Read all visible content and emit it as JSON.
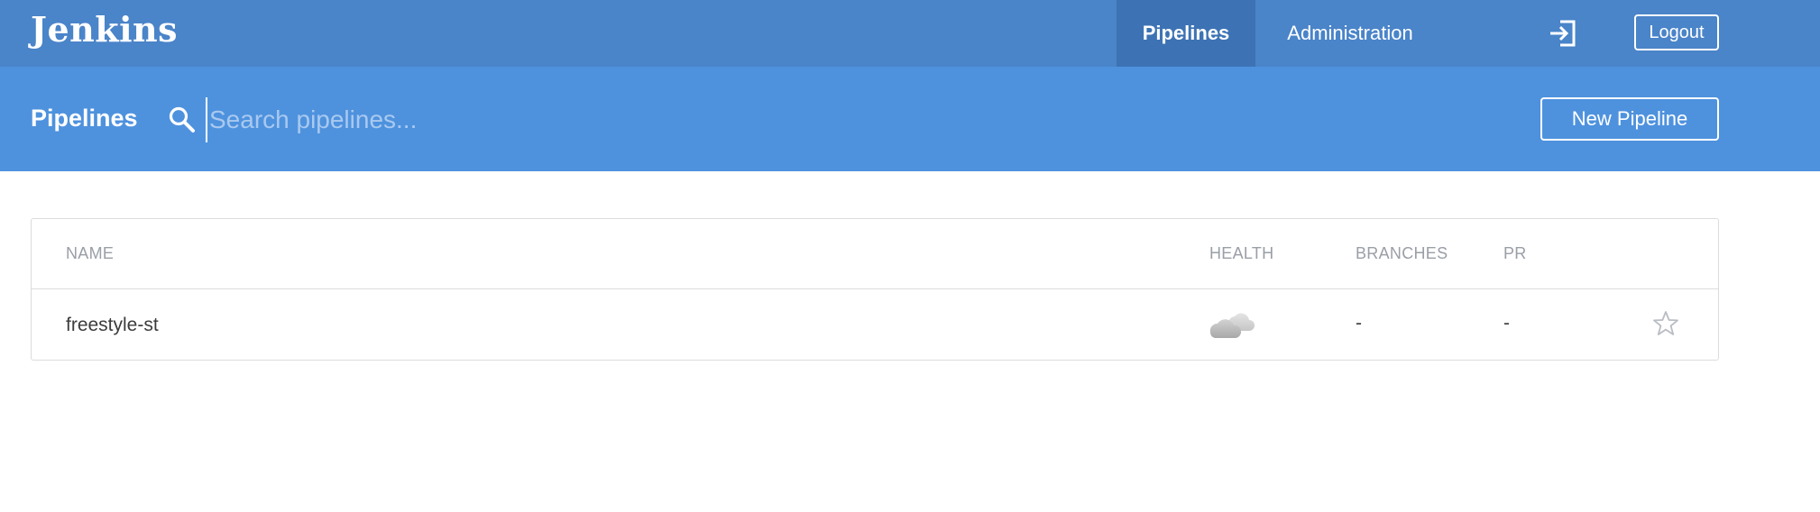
{
  "app": {
    "logo": "Jenkins"
  },
  "topnav": {
    "tabs": [
      {
        "label": "Pipelines",
        "active": true
      },
      {
        "label": "Administration",
        "active": false
      }
    ],
    "login_icon": "login-arrow-icon",
    "logout_label": "Logout"
  },
  "subheader": {
    "title": "Pipelines",
    "search_icon": "search-icon",
    "search_placeholder": "Search pipelines...",
    "search_value": "",
    "new_pipeline_label": "New Pipeline"
  },
  "table": {
    "columns": [
      "NAME",
      "HEALTH",
      "BRANCHES",
      "PR"
    ],
    "rows": [
      {
        "name": "freestyle-st",
        "health_icon": "cloudy-weather-icon",
        "branches": "-",
        "pr": "-",
        "favorite_icon": "star-outline-icon",
        "favorited": false
      }
    ]
  },
  "colors": {
    "topbar": "#4a84c9",
    "topbar_active_tab": "#3d73b4",
    "subheader": "#4e92de",
    "header_text": "#9a9ea6",
    "border": "#dcdcdc"
  }
}
